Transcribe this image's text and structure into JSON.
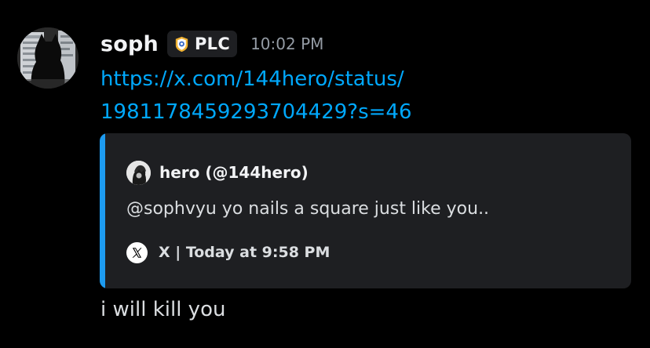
{
  "message": {
    "author": {
      "username": "soph",
      "avatar_icon": "user-avatar-icon",
      "tag": {
        "icon": "guild-tag-icon",
        "text": "PLC"
      }
    },
    "timestamp": "10:02 PM",
    "link": {
      "line1": "https://x.com/144hero/status/",
      "line2": "1981178459293704429?s=46"
    },
    "embed": {
      "accent_color": "#1d9bf0",
      "author": {
        "avatar_icon": "author-avatar-icon",
        "name": "hero (@144hero)"
      },
      "description": "@sophvyu yo nails a square just like you..",
      "footer": {
        "icon": "x-logo-icon",
        "text": "X | Today at 9:58 PM"
      }
    },
    "content": "i will kill you"
  },
  "colors": {
    "background": "#000000",
    "link": "#00a8fc",
    "embed_background": "#1e1f22",
    "timestamp": "#949ba4"
  }
}
